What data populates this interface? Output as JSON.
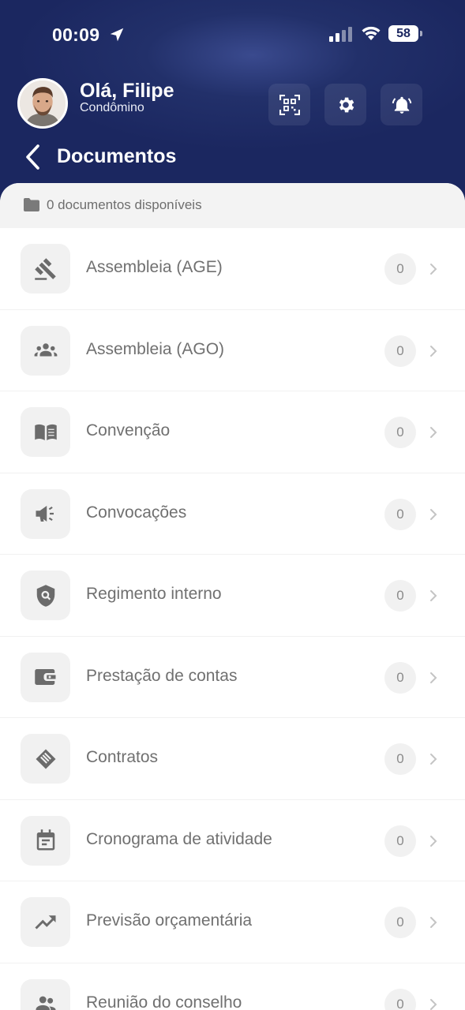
{
  "status_bar": {
    "time": "00:09",
    "battery": "58"
  },
  "header": {
    "greeting": "Olá, Filipe",
    "role": "Condômino",
    "page_title": "Documentos",
    "brand_color": "#1b2760"
  },
  "summary": {
    "text": "0 documentos disponíveis"
  },
  "documents": [
    {
      "label": "Assembleia (AGE)",
      "count": "0",
      "icon": "gavel-icon"
    },
    {
      "label": "Assembleia (AGO)",
      "count": "0",
      "icon": "groups-icon"
    },
    {
      "label": "Convenção",
      "count": "0",
      "icon": "book-icon"
    },
    {
      "label": "Convocações",
      "count": "0",
      "icon": "megaphone-icon"
    },
    {
      "label": "Regimento interno",
      "count": "0",
      "icon": "shield-icon"
    },
    {
      "label": "Prestação de contas",
      "count": "0",
      "icon": "wallet-icon"
    },
    {
      "label": "Contratos",
      "count": "0",
      "icon": "handshake-icon"
    },
    {
      "label": "Cronograma de atividade",
      "count": "0",
      "icon": "calendar-icon"
    },
    {
      "label": "Previsão orçamentária",
      "count": "0",
      "icon": "trending-up-icon"
    },
    {
      "label": "Reunião do conselho",
      "count": "0",
      "icon": "people-icon"
    }
  ]
}
